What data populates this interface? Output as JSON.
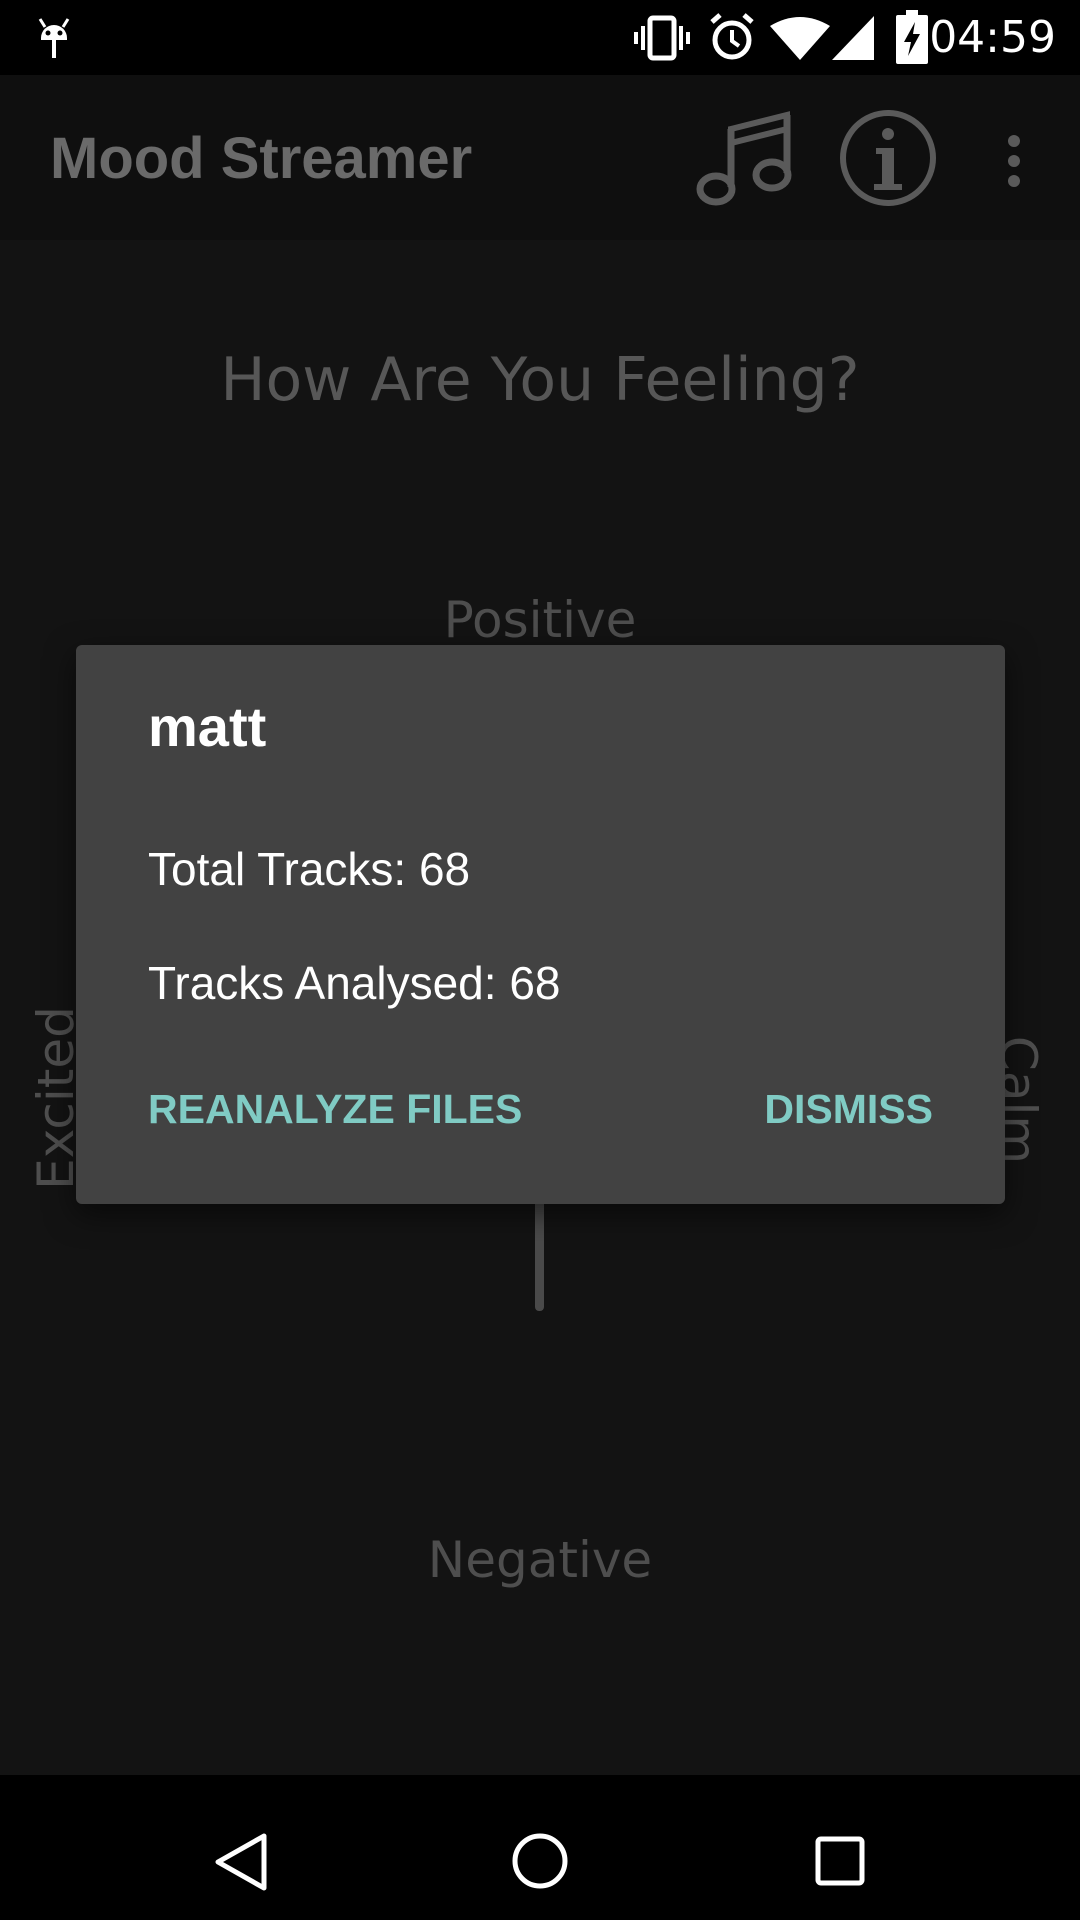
{
  "status_bar": {
    "time": "04:59",
    "icons": [
      "android-debug-icon",
      "vibrate-icon",
      "alarm-icon",
      "wifi-icon",
      "cell-signal-icon",
      "battery-charging-icon"
    ]
  },
  "app_bar": {
    "title": "Mood Streamer",
    "actions": [
      "music-note-icon",
      "info-icon",
      "overflow-menu-icon"
    ]
  },
  "main": {
    "question": "How Are You Feeling?",
    "axis_labels": {
      "top": "Positive",
      "bottom": "Negative",
      "left": "Excited",
      "right": "Calm"
    }
  },
  "dialog": {
    "title": "matt",
    "total_tracks": "Total Tracks: 68",
    "tracks_analysed": "Tracks Analysed: 68",
    "reanalyze_label": "REANALYZE FILES",
    "dismiss_label": "DISMISS"
  },
  "nav_bar": {
    "buttons": [
      "back-icon",
      "home-icon",
      "recents-icon"
    ]
  },
  "colors": {
    "accent": "#80cbc4",
    "dialog_bg": "#424242",
    "content_bg": "#131313",
    "app_bar_bg": "#0f0f0f"
  }
}
